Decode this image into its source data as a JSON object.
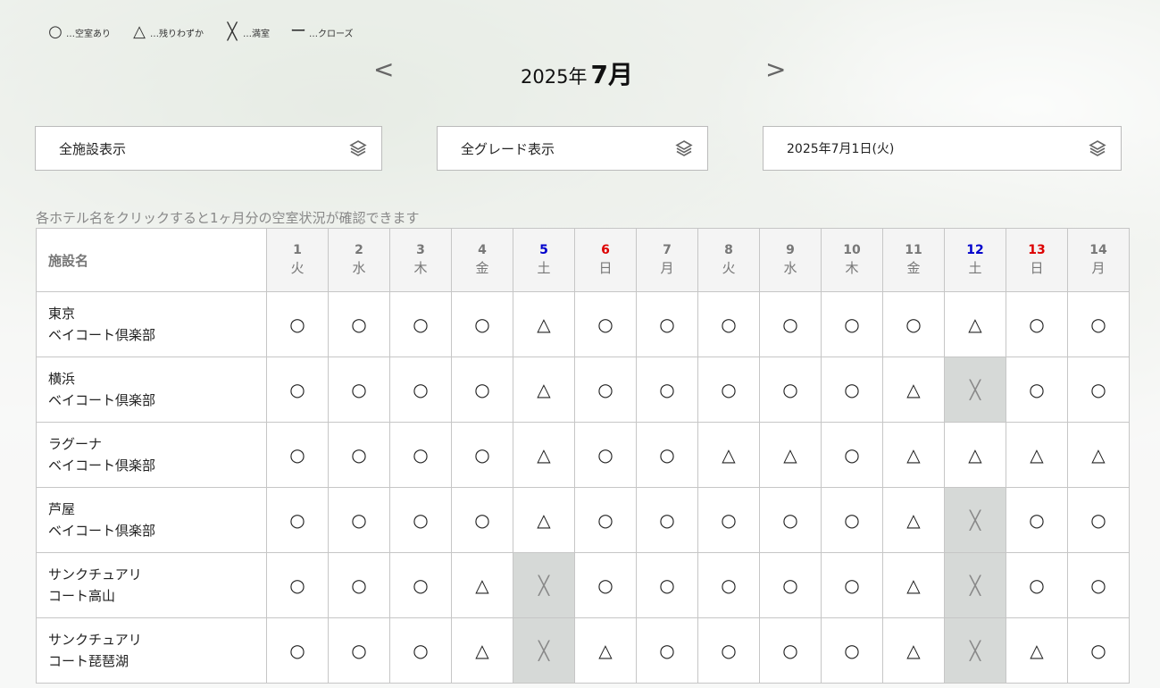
{
  "legend": [
    {
      "symbol": "○",
      "label": "…空室あり"
    },
    {
      "symbol": "△",
      "label": "…残りわずか"
    },
    {
      "symbol": "╳",
      "label": "…満室"
    },
    {
      "symbol": "ー",
      "label": "…クローズ"
    }
  ],
  "nav": {
    "prev": "<",
    "next": ">",
    "year": "2025年",
    "month": "7月"
  },
  "filters": {
    "facility": "全施設表示",
    "grade": "全グレード表示",
    "date": "2025年7月1日(火)",
    "icon": "layers-icon"
  },
  "hint": "各ホテル名をクリックすると1ヶ月分の空室状況が確認できます",
  "table": {
    "name_header": "施設名",
    "days": [
      {
        "num": "1",
        "wd": "火",
        "type": "weekday"
      },
      {
        "num": "2",
        "wd": "水",
        "type": "weekday"
      },
      {
        "num": "3",
        "wd": "木",
        "type": "weekday"
      },
      {
        "num": "4",
        "wd": "金",
        "type": "weekday"
      },
      {
        "num": "5",
        "wd": "土",
        "type": "sat"
      },
      {
        "num": "6",
        "wd": "日",
        "type": "sun"
      },
      {
        "num": "7",
        "wd": "月",
        "type": "weekday"
      },
      {
        "num": "8",
        "wd": "火",
        "type": "weekday"
      },
      {
        "num": "9",
        "wd": "水",
        "type": "weekday"
      },
      {
        "num": "10",
        "wd": "木",
        "type": "weekday"
      },
      {
        "num": "11",
        "wd": "金",
        "type": "weekday"
      },
      {
        "num": "12",
        "wd": "土",
        "type": "sat"
      },
      {
        "num": "13",
        "wd": "日",
        "type": "sun"
      },
      {
        "num": "14",
        "wd": "月",
        "type": "weekday"
      }
    ],
    "rows": [
      {
        "line1": "東京",
        "line2": "ベイコート倶楽部",
        "cells": [
          "○",
          "○",
          "○",
          "○",
          "△",
          "○",
          "○",
          "○",
          "○",
          "○",
          "○",
          "△",
          "○",
          "○"
        ]
      },
      {
        "line1": "横浜",
        "line2": "ベイコート倶楽部",
        "cells": [
          "○",
          "○",
          "○",
          "○",
          "△",
          "○",
          "○",
          "○",
          "○",
          "○",
          "△",
          "╳",
          "○",
          "○"
        ]
      },
      {
        "line1": "ラグーナ",
        "line2": "ベイコート倶楽部",
        "cells": [
          "○",
          "○",
          "○",
          "○",
          "△",
          "○",
          "○",
          "△",
          "△",
          "○",
          "△",
          "△",
          "△",
          "△"
        ]
      },
      {
        "line1": "芦屋",
        "line2": "ベイコート倶楽部",
        "cells": [
          "○",
          "○",
          "○",
          "○",
          "△",
          "○",
          "○",
          "○",
          "○",
          "○",
          "△",
          "╳",
          "○",
          "○"
        ]
      },
      {
        "line1": "サンクチュアリ",
        "line2": "コート高山",
        "cells": [
          "○",
          "○",
          "○",
          "△",
          "╳",
          "○",
          "○",
          "○",
          "○",
          "○",
          "△",
          "╳",
          "○",
          "○"
        ]
      },
      {
        "line1": "サンクチュアリ",
        "line2": "コート琵琶湖",
        "cells": [
          "○",
          "○",
          "○",
          "△",
          "╳",
          "△",
          "○",
          "○",
          "○",
          "○",
          "△",
          "╳",
          "△",
          "○"
        ]
      }
    ]
  }
}
